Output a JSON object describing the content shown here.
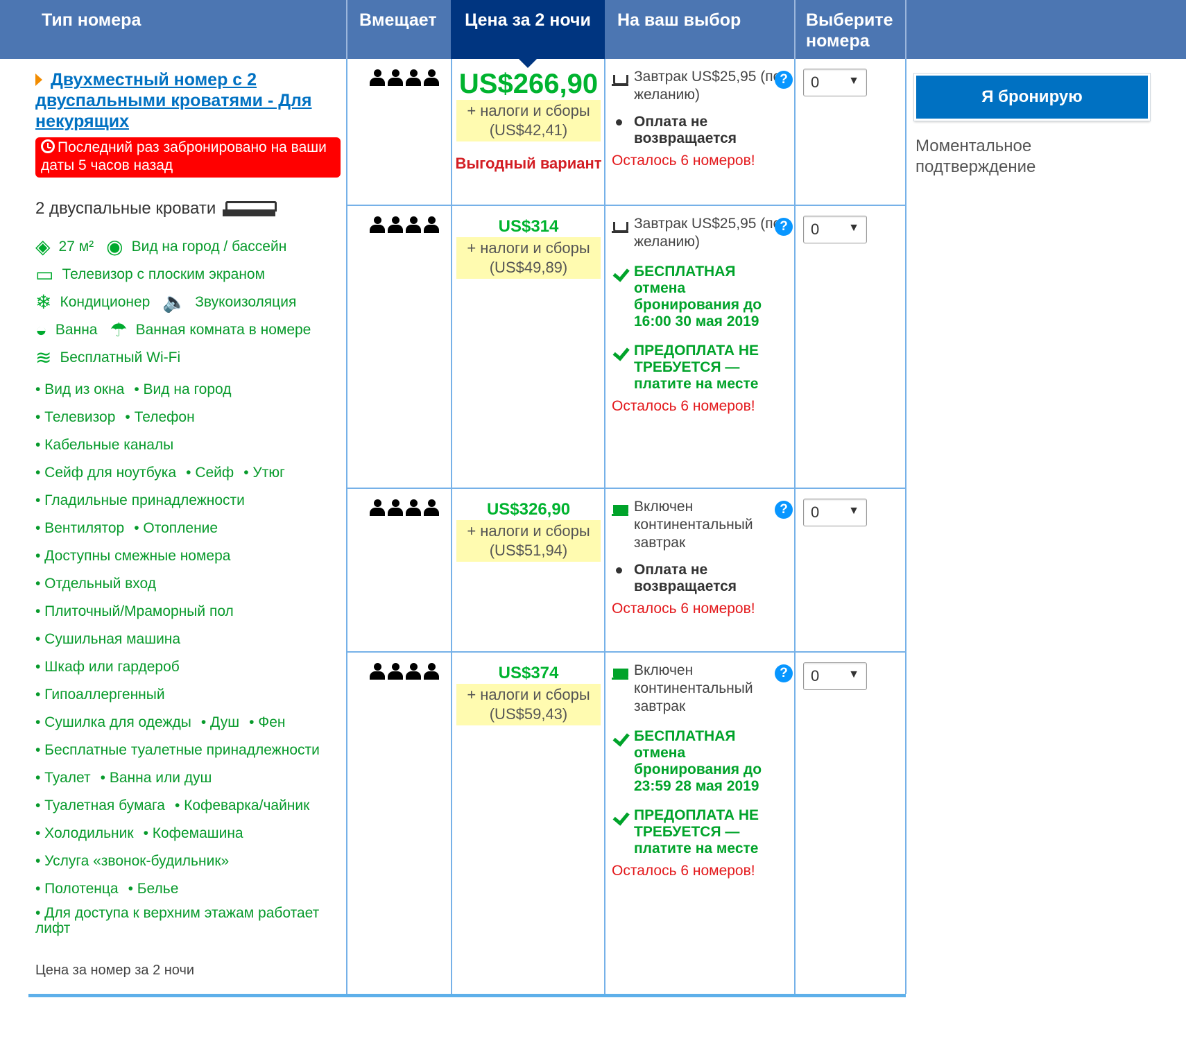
{
  "header": {
    "room_type": "Тип номера",
    "capacity": "Вмещает",
    "price": "Цена за 2 ночи",
    "choice": "На ваш выбор",
    "select": "Выберите номера"
  },
  "room": {
    "title": "Двухместный номер с 2 двуспальными кроватями - Для некурящих",
    "last_booked": "Последний раз забронировано на ваши даты 5 часов назад",
    "beds": "2 двуспальные кровати",
    "facilities": [
      {
        "icon": "room-size-icon",
        "label": "27 м²"
      },
      {
        "icon": "eye-icon",
        "label": "Вид на город / бассейн"
      },
      {
        "icon": "tv-icon",
        "label": "Телевизор с плоским экраном"
      },
      {
        "icon": "snowflake-icon",
        "label": "Кондиционер"
      },
      {
        "icon": "speaker-icon",
        "label": "Звукоизоляция"
      },
      {
        "icon": "bath-icon",
        "label": "Ванна"
      },
      {
        "icon": "shower-icon",
        "label": "Ванная комната в номере"
      },
      {
        "icon": "wifi-icon",
        "label": "Бесплатный Wi-Fi"
      }
    ],
    "amenities": [
      [
        "• Вид из окна",
        "• Вид на город"
      ],
      [
        "• Телевизор",
        "• Телефон"
      ],
      [
        "• Кабельные каналы"
      ],
      [
        "• Сейф для ноутбука",
        "• Сейф",
        "• Утюг"
      ],
      [
        "• Гладильные принадлежности"
      ],
      [
        "• Вентилятор",
        "• Отопление"
      ],
      [
        "• Доступны смежные номера"
      ],
      [
        "• Отдельный вход"
      ],
      [
        "• Плиточный/Мраморный пол"
      ],
      [
        "• Сушильная машина"
      ],
      [
        "• Шкаф или гардероб"
      ],
      [
        "• Гипоаллергенный"
      ],
      [
        "• Сушилка для одежды",
        "• Душ",
        "• Фен"
      ],
      [
        "• Бесплатные туалетные принадлежности"
      ],
      [
        "• Туалет",
        "• Ванна или душ"
      ],
      [
        "• Туалетная бумага",
        "• Кофеварка/чайник"
      ],
      [
        "• Холодильник",
        "• Кофемашина"
      ],
      [
        "• Услуга «звонок-будильник»"
      ],
      [
        "• Полотенца",
        "• Белье"
      ],
      [
        "• Для доступа к верхним этажам работает лифт"
      ]
    ],
    "price_note": "Цена за номер за 2 ночи"
  },
  "options": [
    {
      "price": "US$266,90",
      "taxes": "+ налоги и сборы (US$42,41)",
      "badge": "Выгодный вариант",
      "meal": "Завтрак US$25,95 (по желанию)",
      "policies": [
        "Оплата не возвращается"
      ],
      "left": "Осталось 6 номеров!",
      "qty": "0"
    },
    {
      "price": "US$314",
      "taxes": "+ налоги и сборы (US$49,89)",
      "meal": "Завтрак US$25,95 (по желанию)",
      "policies": [
        "БЕСПЛАТНАЯ отмена бронирования до 16:00 30 мая 2019",
        "ПРЕДОПЛАТА НЕ ТРЕБУЕТСЯ — платите на месте"
      ],
      "left": "Осталось 6 номеров!",
      "qty": "0"
    },
    {
      "price": "US$326,90",
      "taxes": "+ налоги и сборы (US$51,94)",
      "meal": "Включен континентальный завтрак",
      "policies": [
        "Оплата не возвращается"
      ],
      "left": "Осталось 6 номеров!",
      "qty": "0"
    },
    {
      "price": "US$374",
      "taxes": "+ налоги и сборы (US$59,43)",
      "meal": "Включен континентальный завтрак",
      "policies": [
        "БЕСПЛАТНАЯ отмена бронирования до 23:59 28 мая 2019",
        "ПРЕДОПЛАТА НЕ ТРЕБУЕТСЯ — платите на месте"
      ],
      "left": "Осталось 6 номеров!",
      "qty": "0"
    }
  ],
  "booking": {
    "button": "Я бронирую",
    "instant": "Моментальное подтверждение"
  },
  "help_glyph": "?",
  "select_arrow": "▼",
  "colors": {
    "header_bg": "#4c76b2",
    "header_active": "#003580",
    "price_green": "#00b32f",
    "alert_red": "#ff0000",
    "button_blue": "#0071c2"
  }
}
